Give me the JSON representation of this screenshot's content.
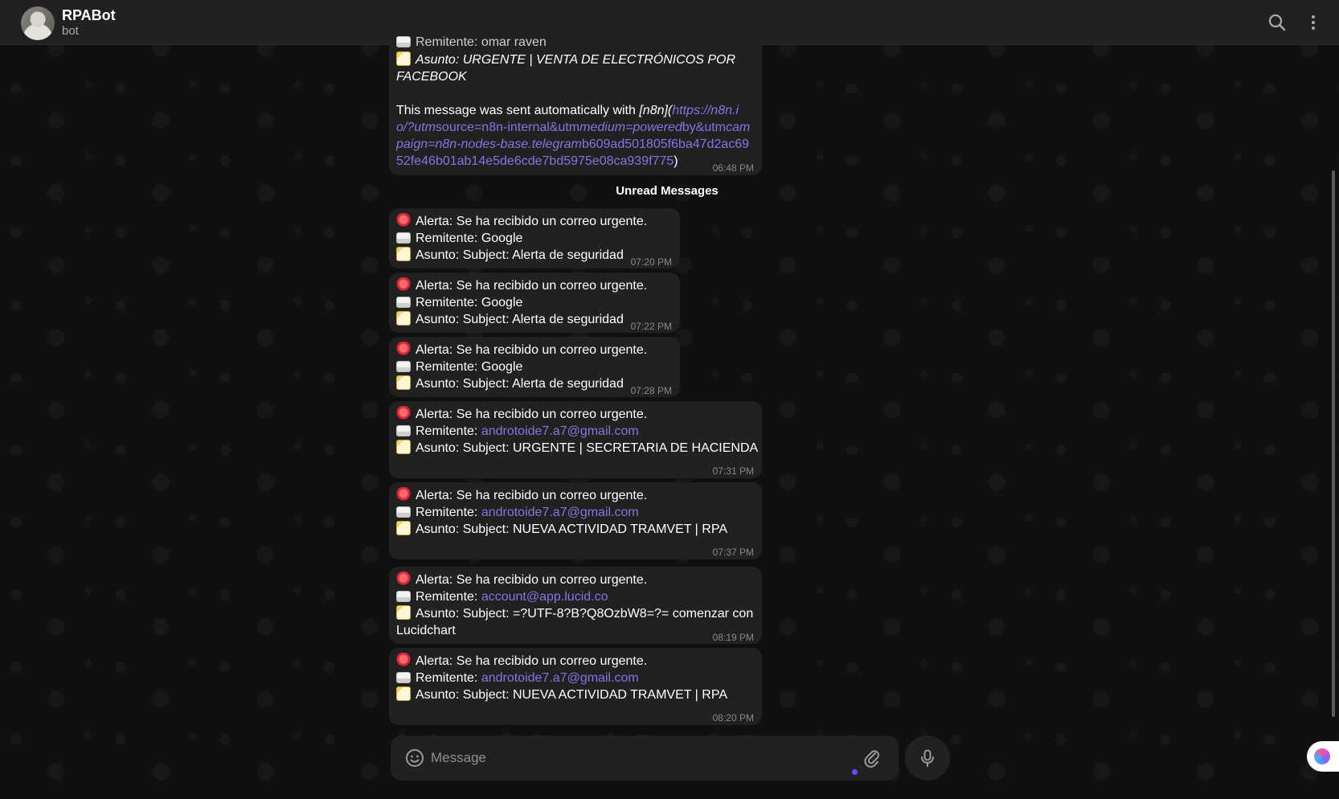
{
  "header": {
    "title": "RPABot",
    "subtitle": "bot"
  },
  "first_message": {
    "line_top": "Remitente: omar raven",
    "asunto_1": "Asunto: URGENTE | VENTA DE ELECTRÓNICOS POR",
    "asunto_2": "FACEBOOK",
    "sent_prefix": "This message was sent automatically with ",
    "n8n_label": "[n8n](",
    "link_1": "https://n8n.i",
    "link_2a": "o/?utm",
    "link_2b": "source=n8n-internal&utm",
    "link_2c": "medium=powered",
    "link_2d": "by&utm",
    "link_2e": "cam",
    "link_3a": "paign=n8n-nodes-base.telegram",
    "link_3b": "b609ad501805f6ba47d2ac69",
    "link_4": "52fe46b01ab14e5de6cde7bd5975e08ca939f775",
    "link_4_close": ")",
    "time": "06:48 PM"
  },
  "unread_label": "Unread Messages",
  "messages": [
    {
      "alert": "Alerta: Se ha recibido un correo urgente.",
      "sender_label": "Remitente: ",
      "sender": "Google",
      "subject": "Asunto: Subject: Alerta de seguridad",
      "time": "07:20 PM"
    },
    {
      "alert": "Alerta: Se ha recibido un correo urgente.",
      "sender_label": "Remitente: ",
      "sender": "Google",
      "subject": "Asunto: Subject: Alerta de seguridad",
      "time": "07:22 PM"
    },
    {
      "alert": "Alerta: Se ha recibido un correo urgente.",
      "sender_label": "Remitente: ",
      "sender": "Google",
      "subject": "Asunto: Subject: Alerta de seguridad",
      "time": "07:28 PM"
    },
    {
      "alert": "Alerta: Se ha recibido un correo urgente.",
      "sender_label": "Remitente: ",
      "sender": "androtoide7.a7@gmail.com",
      "subject": "Asunto: Subject: URGENTE | SECRETARIA DE HACIENDA",
      "time": "07:31 PM"
    },
    {
      "alert": "Alerta: Se ha recibido un correo urgente.",
      "sender_label": "Remitente: ",
      "sender": "androtoide7.a7@gmail.com",
      "subject": "Asunto: Subject: NUEVA ACTIVIDAD TRAMVET | RPA",
      "time": "07:37 PM"
    },
    {
      "alert": "Alerta: Se ha recibido un correo urgente.",
      "sender_label": "Remitente: ",
      "sender": "account@app.lucid.co",
      "subject": "Asunto: Subject: =?UTF-8?B?Q8OzbW8=?= comenzar con",
      "subject_cont": "Lucidchart",
      "time": "08:19 PM"
    },
    {
      "alert": "Alerta: Se ha recibido un correo urgente.",
      "sender_label": "Remitente: ",
      "sender": "androtoide7.a7@gmail.com",
      "subject": "Asunto: Subject: NUEVA ACTIVIDAD TRAMVET | RPA",
      "time": "08:20 PM"
    }
  ],
  "composer": {
    "placeholder": "Message"
  },
  "icons": {
    "search": "search-icon",
    "menu": "more-vertical-icon",
    "emoji": "smile-icon",
    "attach": "paperclip-icon",
    "mic": "microphone-icon"
  },
  "colors": {
    "link": "#8774e1",
    "bubble": "#212121",
    "header": "#212121"
  }
}
